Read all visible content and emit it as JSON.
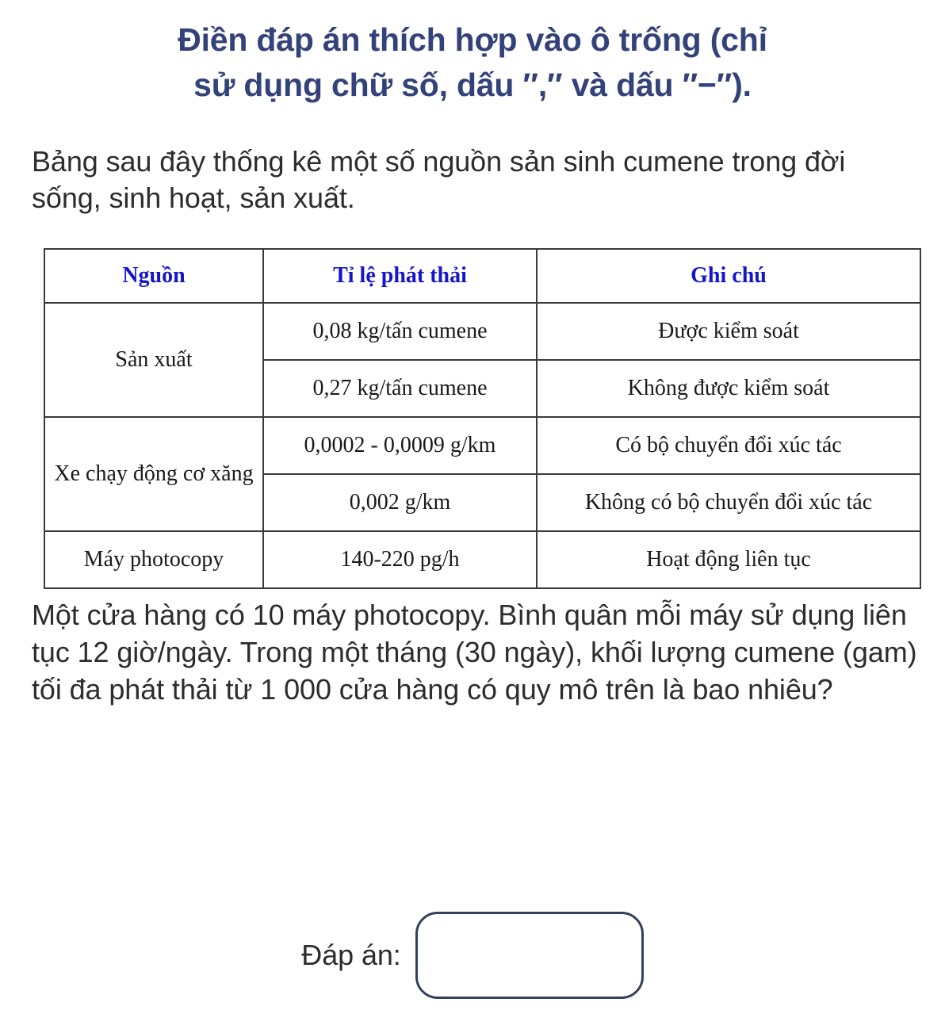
{
  "heading": {
    "line1": "Điền đáp án thích hợp vào ô trống (chỉ",
    "line2": "sử dụng chữ số, dấu ″,″ và dấu ″−″).",
    "color": "#33427A"
  },
  "intro": {
    "text": "Bảng sau đây thống kê một số nguồn sản sinh cumene trong đời sống, sinh hoạt, sản xuất."
  },
  "table": {
    "header_color": "#1515CC",
    "border_color": "#3A3A3A",
    "columns": [
      "Nguồn",
      "Tỉ lệ phát thải",
      "Ghi chú"
    ],
    "rows": [
      {
        "source": "Sản xuất",
        "source_rowspan": 2,
        "rate": "0,08 kg/tấn cumene",
        "note": "Được kiểm soát"
      },
      {
        "source": null,
        "rate": "0,27 kg/tấn cumene",
        "note": "Không được kiểm soát"
      },
      {
        "source": "Xe chạy động cơ xăng",
        "source_rowspan": 2,
        "rate": "0,0002 - 0,0009 g/km",
        "note": "Có bộ chuyển đổi xúc tác"
      },
      {
        "source": null,
        "rate": "0,002 g/km",
        "note": "Không có bộ chuyển đổi xúc tác"
      },
      {
        "source": "Máy photocopy",
        "source_rowspan": 1,
        "rate": "140-220 pg/h",
        "note": "Hoạt động liên tục"
      }
    ]
  },
  "question": {
    "text": "Một cửa hàng có 10 máy photocopy. Bình quân mỗi máy sử dụng liên tục 12 giờ/ngày. Trong một tháng (30 ngày), khối lượng cumene (gam) tối đa phát thải từ 1 000 cửa hàng có quy mô trên là bao nhiêu?"
  },
  "answer": {
    "label": "Đáp án:",
    "value": "",
    "placeholder": "",
    "border_color": "#32405C"
  }
}
